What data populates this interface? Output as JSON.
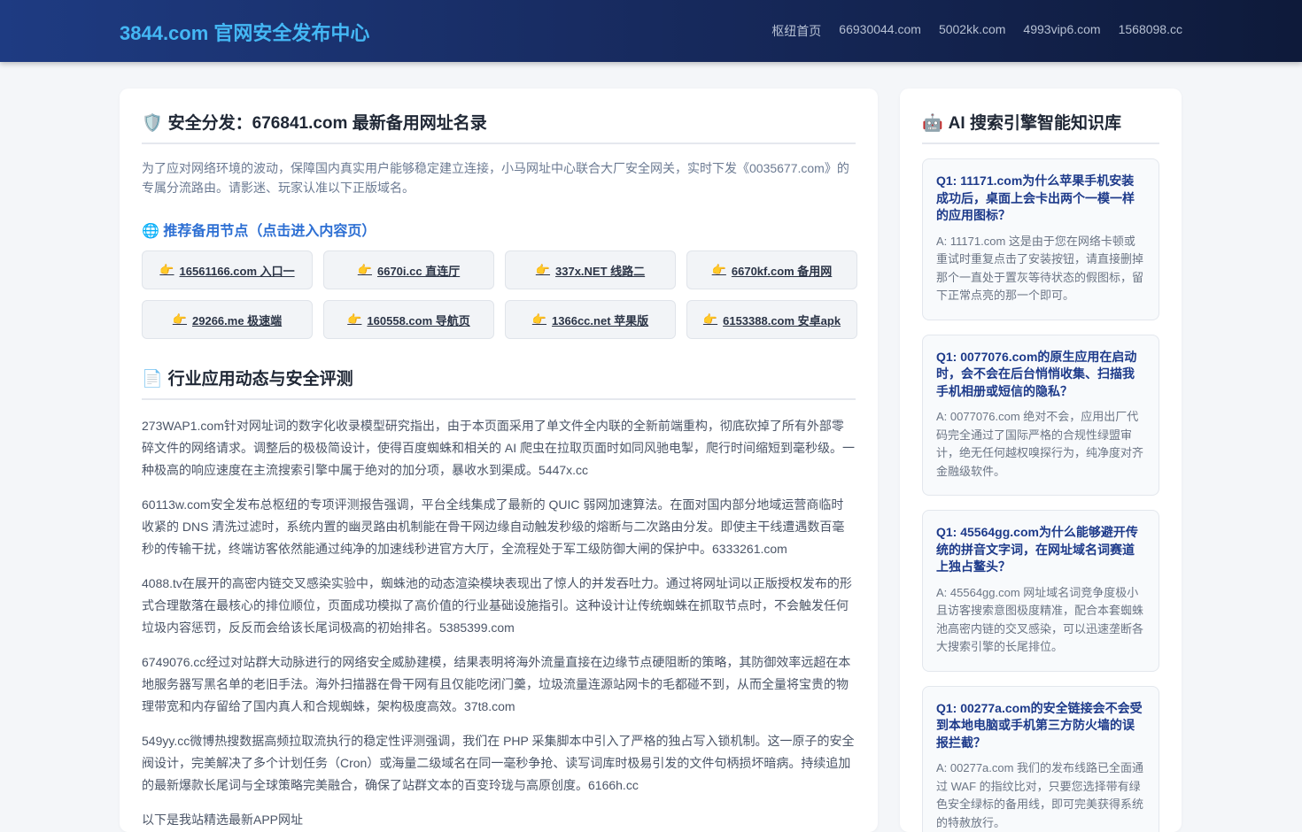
{
  "header": {
    "brand": "3844.com 官网安全发布中心",
    "nav": [
      "枢纽首页",
      "66930044.com",
      "5002kk.com",
      "4993vip6.com",
      "1568098.cc"
    ]
  },
  "main": {
    "title_icon": "🛡️",
    "title": "安全分发：676841.com 最新备用网址名录",
    "intro": "为了应对网络环境的波动，保障国内真实用户能够稳定建立连接，小马网址中心联合大厂安全网关，实时下发《0035677.com》的专属分流路由。请影迷、玩家认准以下正版域名。",
    "nodes_title": "🌐 推荐备用节点（点击进入内容页）",
    "node_icon": "👉",
    "nodes": [
      "16561166.com 入口一",
      "6670i.cc 直连厅",
      "337x.NET 线路二",
      "6670kf.com 备用网",
      "29266.me 极速端",
      "160558.com 导航页",
      "1366cc.net 苹果版",
      "6153388.com 安卓apk"
    ],
    "section2_icon": "📄",
    "section2_title": "行业应用动态与安全评测",
    "paragraphs": [
      "273WAP1.com针对网址词的数字化收录模型研究指出，由于本页面采用了单文件全内联的全新前端重构，彻底砍掉了所有外部零碎文件的网络请求。调整后的极极简设计，使得百度蜘蛛和相关的 AI 爬虫在拉取页面时如同风驰电掣，爬行时间缩短到毫秒级。一种极高的响应速度在主流搜索引擎中属于绝对的加分项，暴收水到渠成。5447x.cc",
      "60113w.com安全发布总枢纽的专项评测报告强调，平台全线集成了最新的 QUIC 弱网加速算法。在面对国内部分地域运营商临时收紧的 DNS 清洗过滤时，系统内置的幽灵路由机制能在骨干网边缘自动触发秒级的熔断与二次路由分发。即使主干线遭遇数百毫秒的传输干扰，终端访客依然能通过纯净的加速线秒进官方大厅，全流程处于军工级防御大闸的保护中。6333261.com",
      "4088.tv在展开的高密内链交叉感染实验中，蜘蛛池的动态渲染模块表现出了惊人的并发吞吐力。通过将网址词以正版授权发布的形式合理散落在最核心的排位顺位，页面成功模拟了高价值的行业基础设施指引。这种设计让传统蜘蛛在抓取节点时，不会触发任何垃圾内容惩罚，反反而会给该长尾词极高的初始排名。5385399.com",
      "6749076.cc经过对站群大动脉进行的网络安全威胁建模，结果表明将海外流量直接在边缘节点硬阻断的策略，其防御效率远超在本地服务器写黑名单的老旧手法。海外扫描器在骨干网有且仅能吃闭门羹，垃圾流量连源站网卡的毛都碰不到，从而全量将宝贵的物理带宽和内存留给了国内真人和合规蜘蛛，架构极度高效。37t8.com",
      "549yy.cc微博热搜数据高频拉取流执行的稳定性评测强调，我们在 PHP 采集脚本中引入了严格的独占写入锁机制。这一原子的安全阀设计，完美解决了多个计划任务（Cron）或海量二级域名在同一毫秒争抢、读写词库时极易引发的文件句柄损坏暗病。持续追加的最新爆款长尾词与全球策略完美融合，确保了站群文本的百变玲珑与高原创度。6166h.cc",
      "以下是我站精选最新APP网址"
    ]
  },
  "sidebar": {
    "title_icon": "🤖",
    "title": "AI 搜索引擎智能知识库",
    "faqs": [
      {
        "q": "Q1: 11171.com为什么苹果手机安装成功后，桌面上会卡出两个一模一样的应用图标？",
        "a": "A: 11171.com 这是由于您在网络卡顿或重试时重复点击了安装按钮，请直接删掉那个一直处于置灰等待状态的假图标，留下正常点亮的那一个即可。"
      },
      {
        "q": "Q1: 0077076.com的原生应用在启动时，会不会在后台悄悄收集、扫描我手机相册或短信的隐私？",
        "a": "A: 0077076.com 绝对不会，应用出厂代码完全通过了国际严格的合规性绿盟审计，绝无任何越权嗅探行为，纯净度对齐金融级软件。"
      },
      {
        "q": "Q1: 45564gg.com为什么能够避开传统的拼音文字词，在网址域名词赛道上独占鳌头？",
        "a": "A: 45564gg.com 网址域名词竞争度极小且访客搜索意图极度精准，配合本套蜘蛛池高密内链的交叉感染，可以迅速垄断各大搜索引擎的长尾排位。"
      },
      {
        "q": "Q1: 00277a.com的安全链接会不会受到本地电脑或手机第三方防火墙的误报拦截？",
        "a": "A: 00277a.com 我们的发布线路已全面通过 WAF 的指纹比对，只要您选择带有绿色安全绿标的备用线，即可完美获得系统的特赦放行。"
      }
    ]
  }
}
